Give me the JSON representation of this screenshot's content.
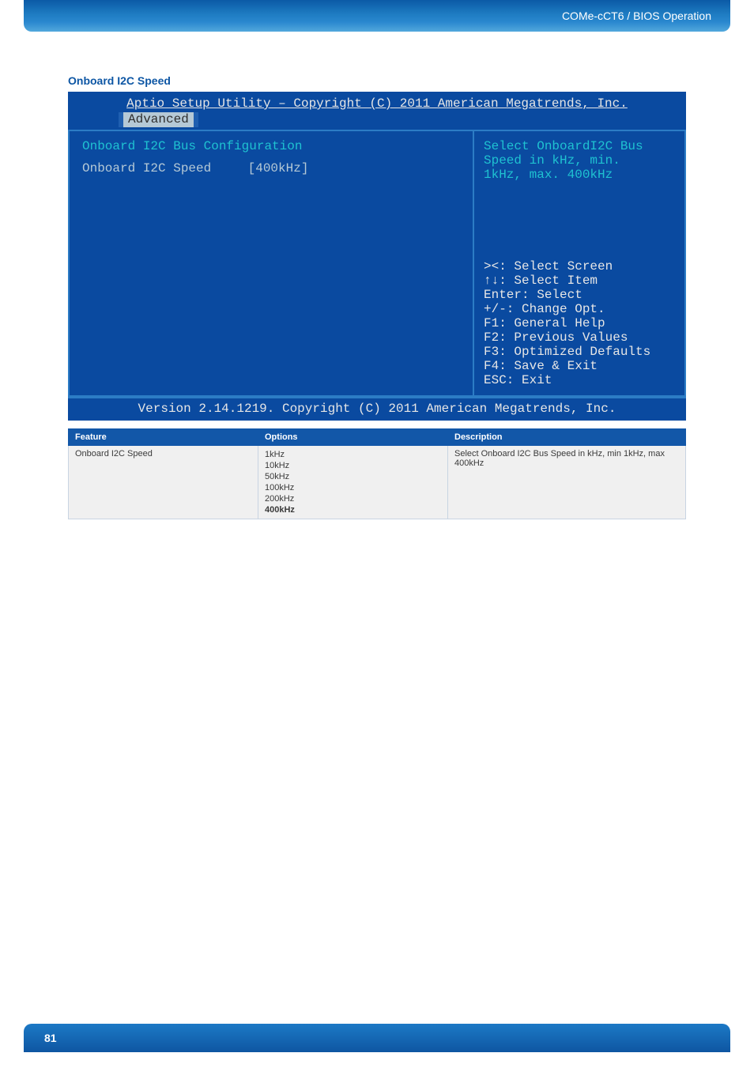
{
  "header": {
    "breadcrumb": "COMe-cCT6 / BIOS Operation"
  },
  "section": {
    "title": "Onboard I2C Speed"
  },
  "bios": {
    "title": "Aptio Setup Utility – Copyright (C) 2011 American Megatrends, Inc.",
    "tab": "Advanced",
    "left": {
      "config_title": "Onboard I2C Bus Configuration",
      "row_label": "Onboard I2C Speed",
      "row_value": "[400kHz]"
    },
    "right": {
      "help1": "Select OnboardI2C Bus",
      "help2": "Speed in kHz, min.",
      "help3": "1kHz, max. 400kHz",
      "k1": "><: Select Screen",
      "k2": "↑↓: Select Item",
      "k3": "Enter: Select",
      "k4": "+/-: Change Opt.",
      "k5": "F1: General Help",
      "k6": "F2: Previous Values",
      "k7": "F3: Optimized Defaults",
      "k8": "F4: Save & Exit",
      "k9": "ESC: Exit"
    },
    "footer": "Version 2.14.1219. Copyright (C) 2011 American Megatrends, Inc."
  },
  "table": {
    "headers": {
      "feature": "Feature",
      "options": "Options",
      "description": "Description"
    },
    "row": {
      "feature": "Onboard I2C Speed",
      "options": {
        "o1": "1kHz",
        "o2": "10kHz",
        "o3": "50kHz",
        "o4": "100kHz",
        "o5": "200kHz",
        "o6": "400kHz"
      },
      "description": "Select Onboard I2C Bus Speed in kHz, min 1kHz, max 400kHz"
    }
  },
  "footer": {
    "page_number": "81"
  }
}
